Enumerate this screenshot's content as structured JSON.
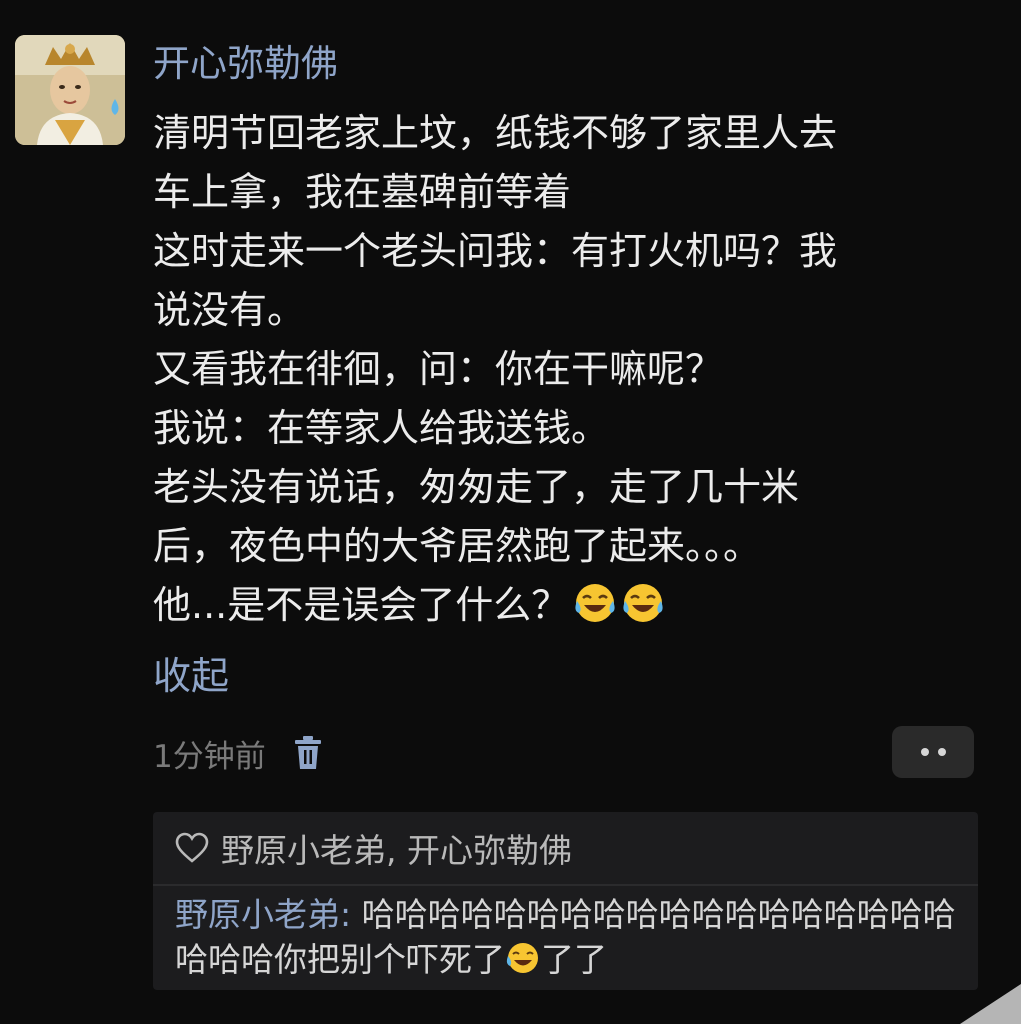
{
  "post": {
    "username": "开心弥勒佛",
    "lines": [
      "清明节回老家上坟，纸钱不够了家里人去",
      "车上拿，我在墓碑前等着",
      "这时走来一个老头问我：有打火机吗？我",
      "说没有。",
      "又看我在徘徊，问：你在干嘛呢？",
      "我说：在等家人给我送钱。",
      "老头没有说话，匆匆走了，走了几十米",
      "后，夜色中的大爷居然跑了起来。。。",
      "他...是不是误会了什么？"
    ],
    "emoji": "crying-laughing-emoji",
    "collapse_label": "收起",
    "timestamp": "1分钟前"
  },
  "reply_section": {
    "likes_text": "野原小老弟, 开心弥勒佛",
    "comment_author": "野原小老弟:",
    "comment_text": " 哈哈哈哈哈哈哈哈哈哈哈哈哈哈哈哈哈哈哈哈哈你把别个吓死了",
    "comment_tail": "了了"
  },
  "colors": {
    "background": "#0c0c0c",
    "name_blue": "#8fa5c9",
    "text": "#ececec",
    "muted": "#7a7a7a",
    "reply_bg": "#1c1c1e"
  },
  "icons": [
    "trash-icon",
    "more-dots-icon",
    "heart-icon",
    "crying-laughing-emoji",
    "avatar-image"
  ]
}
